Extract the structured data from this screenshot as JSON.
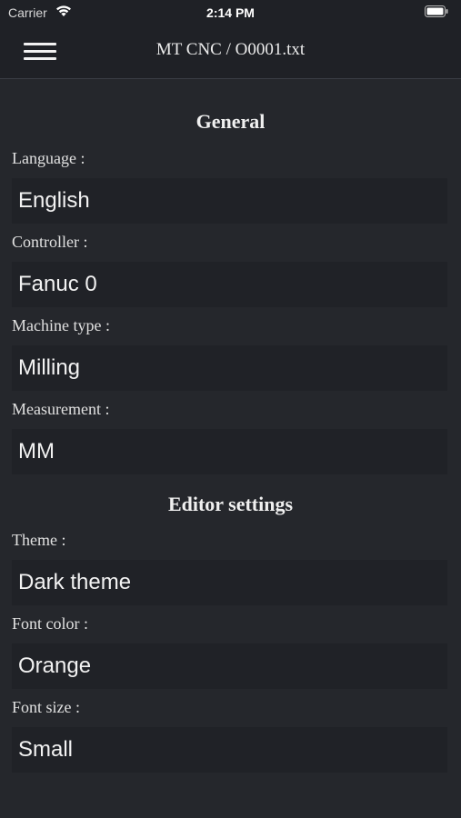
{
  "status_bar": {
    "carrier": "Carrier",
    "time": "2:14 PM"
  },
  "nav": {
    "title": "MT CNC / O0001.txt"
  },
  "sections": {
    "general": {
      "title": "General",
      "language_label": "Language :",
      "language_value": "English",
      "controller_label": "Controller :",
      "controller_value": "Fanuc 0",
      "machine_type_label": "Machine type :",
      "machine_type_value": "Milling",
      "measurement_label": "Measurement :",
      "measurement_value": "MM"
    },
    "editor": {
      "title": "Editor settings",
      "theme_label": "Theme :",
      "theme_value": "Dark theme",
      "font_color_label": "Font color :",
      "font_color_value": "Orange",
      "font_size_label": "Font size :",
      "font_size_value": "Small"
    }
  },
  "colors": {
    "background": "#25272c",
    "field_background": "#202227",
    "text": "#e6e6e6"
  }
}
